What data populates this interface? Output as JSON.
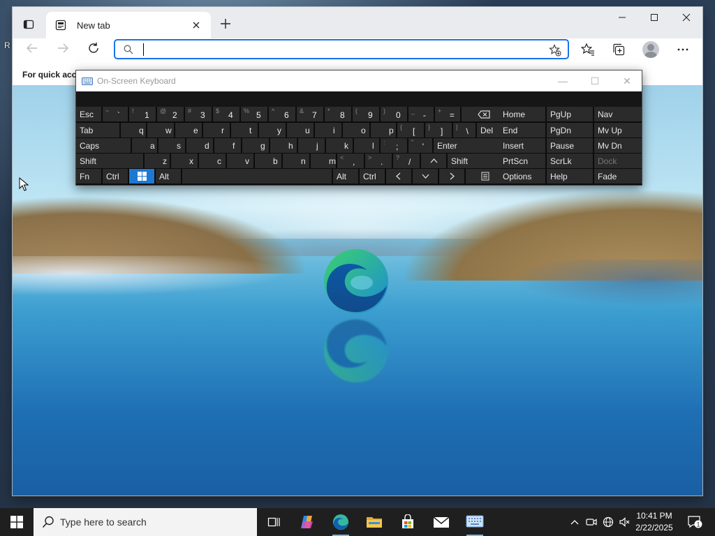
{
  "desktop": {
    "icon_label_fragment": "R"
  },
  "browser": {
    "tab_title": "New tab",
    "address_placeholder": "",
    "favorites_bar_text": "For quick access, place your favorites here on the favorites bar. Manage favorites now"
  },
  "osk": {
    "title": "On-Screen Keyboard",
    "rows": [
      [
        {
          "label": "Esc"
        },
        {
          "shift": "~",
          "main": "`"
        },
        {
          "shift": "!",
          "main": "1"
        },
        {
          "shift": "@",
          "main": "2"
        },
        {
          "shift": "#",
          "main": "3"
        },
        {
          "shift": "$",
          "main": "4"
        },
        {
          "shift": "%",
          "main": "5"
        },
        {
          "shift": "^",
          "main": "6"
        },
        {
          "shift": "&",
          "main": "7"
        },
        {
          "shift": "*",
          "main": "8"
        },
        {
          "shift": "(",
          "main": "9"
        },
        {
          "shift": ")",
          "main": "0"
        },
        {
          "shift": "_",
          "main": "-"
        },
        {
          "shift": "+",
          "main": "="
        },
        {
          "label": "⌫"
        }
      ],
      [
        {
          "label": "Tab"
        },
        {
          "label": "q"
        },
        {
          "label": "w"
        },
        {
          "label": "e"
        },
        {
          "label": "r"
        },
        {
          "label": "t"
        },
        {
          "label": "y"
        },
        {
          "label": "u"
        },
        {
          "label": "i"
        },
        {
          "label": "o"
        },
        {
          "label": "p"
        },
        {
          "shift": "{",
          "main": "["
        },
        {
          "shift": "}",
          "main": "]"
        },
        {
          "shift": "|",
          "main": "\\"
        },
        {
          "label": "Del"
        }
      ],
      [
        {
          "label": "Caps"
        },
        {
          "label": "a"
        },
        {
          "label": "s"
        },
        {
          "label": "d"
        },
        {
          "label": "f"
        },
        {
          "label": "g"
        },
        {
          "label": "h"
        },
        {
          "label": "j"
        },
        {
          "label": "k"
        },
        {
          "label": "l"
        },
        {
          "shift": ":",
          "main": ";"
        },
        {
          "shift": "\"",
          "main": "'"
        },
        {
          "label": "Enter"
        }
      ],
      [
        {
          "label": "Shift"
        },
        {
          "label": "z"
        },
        {
          "label": "x"
        },
        {
          "label": "c"
        },
        {
          "label": "v"
        },
        {
          "label": "b"
        },
        {
          "label": "n"
        },
        {
          "label": "m"
        },
        {
          "shift": "<",
          "main": ","
        },
        {
          "shift": ">",
          "main": "."
        },
        {
          "shift": "?",
          "main": "/"
        },
        {
          "label": "^"
        },
        {
          "label": "Shift"
        }
      ],
      [
        {
          "label": "Fn"
        },
        {
          "label": "Ctrl"
        },
        {
          "label": "win-logo"
        },
        {
          "label": "Alt"
        },
        {
          "label": ""
        },
        {
          "label": "Alt"
        },
        {
          "label": "Ctrl"
        },
        {
          "label": "<"
        },
        {
          "label": "v"
        },
        {
          "label": ">"
        },
        {
          "label": "menu"
        }
      ]
    ],
    "nav_keys": [
      [
        "Home",
        "PgUp",
        "Nav"
      ],
      [
        "End",
        "PgDn",
        "Mv Up"
      ],
      [
        "Insert",
        "Pause",
        "Mv Dn"
      ],
      [
        "PrtScn",
        "ScrLk",
        "Dock"
      ],
      [
        "Options",
        "Help",
        "Fade"
      ]
    ]
  },
  "taskbar": {
    "search_placeholder": "Type here to search",
    "time": "10:41 PM",
    "date": "2/22/2025",
    "notification_count": "1",
    "pinned_icons": [
      "task-view-icon",
      "copilot-icon",
      "edge-icon",
      "file-explorer-icon",
      "store-icon",
      "mail-icon",
      "osk-icon"
    ]
  },
  "colors": {
    "accent": "#1a73e8",
    "win_key": "#1e78d2",
    "taskbar": "#1f1f1f",
    "osk_key": "#2b2b2b"
  }
}
